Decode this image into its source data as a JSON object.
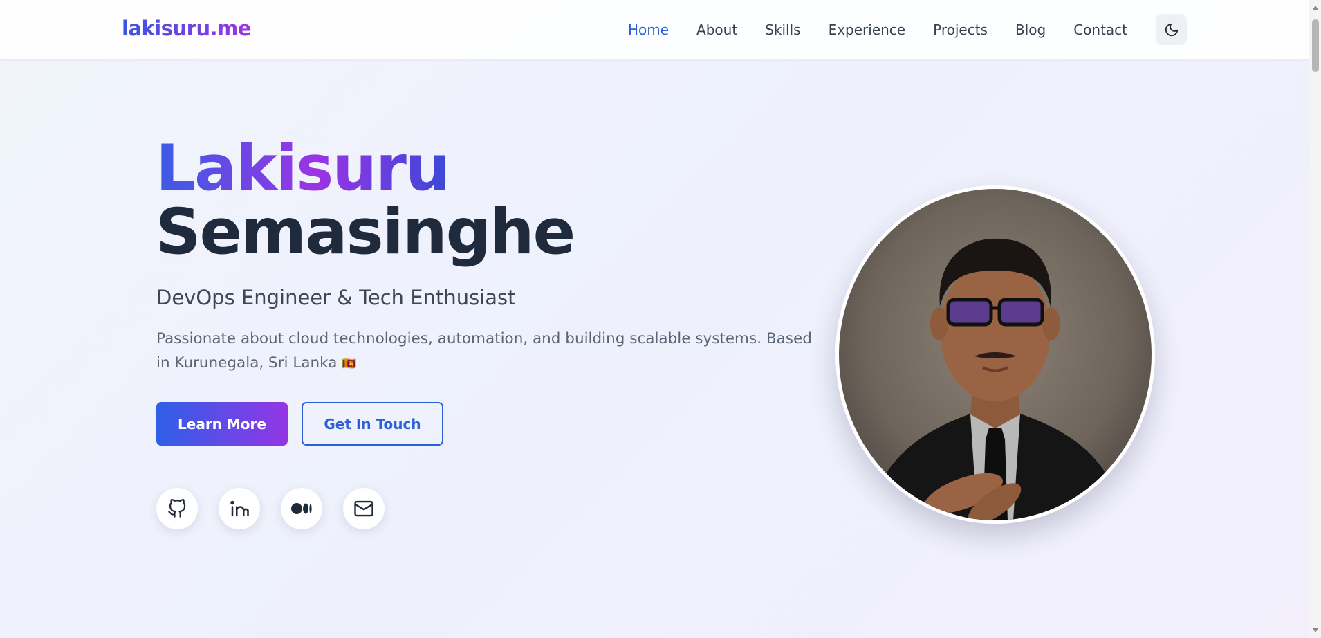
{
  "header": {
    "brand": "lakisuru.me",
    "nav": [
      "Home",
      "About",
      "Skills",
      "Experience",
      "Projects",
      "Blog",
      "Contact"
    ],
    "active_nav": "Home",
    "theme_toggle_icon": "moon-icon"
  },
  "hero": {
    "first_name": "Lakisuru",
    "last_name": "Semasinghe",
    "role": "DevOps Engineer & Tech Enthusiast",
    "description": "Passionate about cloud technologies, automation, and building scalable systems. Based in Kurunegala, Sri Lanka",
    "flag": "🇱🇰",
    "primary_button": "Learn More",
    "secondary_button": "Get In Touch",
    "social_icons": [
      "github-icon",
      "linkedin-icon",
      "medium-icon",
      "mail-icon"
    ],
    "portrait": "profile-photo"
  },
  "colors": {
    "accent": "#2f5fd6",
    "gradient_start": "#3b5ce4",
    "gradient_end": "#9a34e4",
    "heading_dark": "#1f2a3d"
  }
}
